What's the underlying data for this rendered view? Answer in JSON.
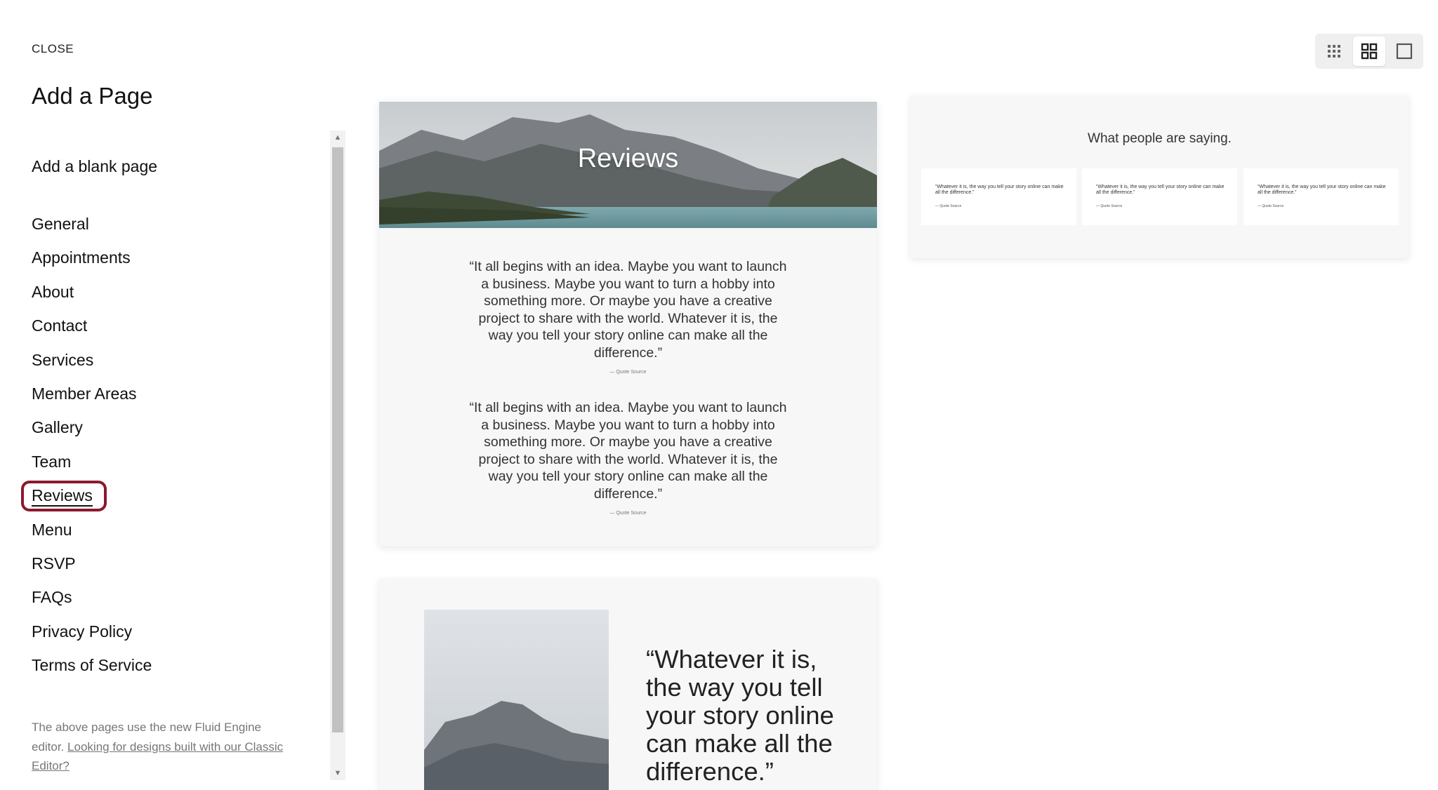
{
  "panel": {
    "close_label": "CLOSE",
    "title": "Add a Page",
    "blank_page_label": "Add a blank page",
    "items": [
      {
        "label": "General"
      },
      {
        "label": "Appointments"
      },
      {
        "label": "About"
      },
      {
        "label": "Contact"
      },
      {
        "label": "Services"
      },
      {
        "label": "Member Areas"
      },
      {
        "label": "Gallery"
      },
      {
        "label": "Team"
      },
      {
        "label": "Reviews",
        "selected": true
      },
      {
        "label": "Menu"
      },
      {
        "label": "RSVP"
      },
      {
        "label": "FAQs"
      },
      {
        "label": "Privacy Policy"
      },
      {
        "label": "Terms of Service"
      }
    ],
    "footnote_text": "The above pages use the new Fluid Engine editor.",
    "footnote_link": "Looking for designs built with our Classic Editor?"
  },
  "view_toggle": {
    "options": [
      {
        "icon": "small-grid-icon",
        "selected": false
      },
      {
        "icon": "medium-grid-icon",
        "selected": true
      },
      {
        "icon": "single-view-icon",
        "selected": false
      }
    ]
  },
  "previews": {
    "card_a": {
      "hero_title": "Reviews",
      "quotes": [
        {
          "text": "“It all begins with an idea. Maybe you want to launch a business. Maybe you want to turn a hobby into something more. Or maybe you have a creative project to share with the world. Whatever it is, the way you tell your story online can make all the difference.”",
          "source": "— Quote Source"
        },
        {
          "text": "“It all begins with an idea. Maybe you want to launch a business. Maybe you want to turn a hobby into something more. Or maybe you have a creative project to share with the world. Whatever it is, the way you tell your story online can make all the difference.”",
          "source": "— Quote Source"
        }
      ]
    },
    "card_b": {
      "heading": "What people are saying.",
      "quotes": [
        {
          "text": "“Whatever it is, the way you tell your story online can make all the difference.”",
          "source": "— Quote Source"
        },
        {
          "text": "“Whatever it is, the way you tell your story online can make all the difference.”",
          "source": "— Quote Source"
        },
        {
          "text": "“Whatever it is, the way you tell your story online can make all the difference.”",
          "source": "— Quote Source"
        }
      ]
    },
    "card_c": {
      "quote": "“Whatever it is, the way you tell your story online can make all the difference.”"
    }
  },
  "colors": {
    "active_ring": "#8b1a2c",
    "card_background": "#f7f7f7",
    "lake": "#6e9aa0"
  }
}
